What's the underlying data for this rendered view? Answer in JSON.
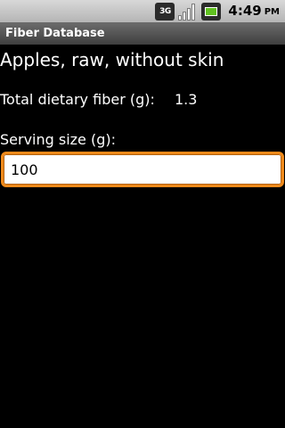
{
  "status_bar": {
    "network_label": "3G",
    "time": "4:49",
    "ampm": "PM",
    "icons": [
      "network-3g-icon",
      "signal-strength-icon",
      "battery-icon"
    ]
  },
  "app": {
    "title": "Fiber Database"
  },
  "food": {
    "name": "Apples, raw, without skin",
    "fiber_label": "Total dietary fiber (g):",
    "fiber_value": "1.3"
  },
  "serving": {
    "label": "Serving size (g):",
    "value": "100"
  },
  "colors": {
    "background": "#000000",
    "text": "#ffffff",
    "focus_border": "#f08a1a",
    "title_bar": "#4a4a4a",
    "status_bar": "#c8c8c8"
  }
}
